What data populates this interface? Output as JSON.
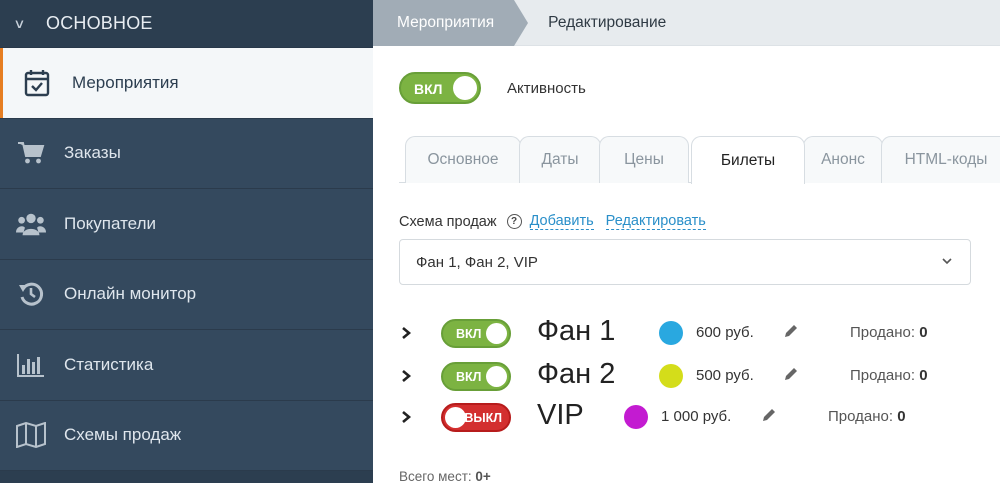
{
  "sidebar": {
    "header": "ОСНОВНОЕ",
    "items": [
      {
        "label": "Мероприятия",
        "icon": "calendar-check-icon",
        "active": true
      },
      {
        "label": "Заказы",
        "icon": "cart-icon"
      },
      {
        "label": "Покупатели",
        "icon": "users-icon"
      },
      {
        "label": "Онлайн монитор",
        "icon": "history-icon"
      },
      {
        "label": "Статистика",
        "icon": "bar-chart-icon"
      },
      {
        "label": "Схемы продаж",
        "icon": "map-icon"
      }
    ]
  },
  "breadcrumb": {
    "first": "Мероприятия",
    "second": "Редактирование"
  },
  "activity": {
    "toggle_label": "ВКЛ",
    "label": "Активность"
  },
  "tabs": [
    {
      "label": "Основное"
    },
    {
      "label": "Даты"
    },
    {
      "label": "Цены"
    },
    {
      "label": "Билеты",
      "active": true
    },
    {
      "label": "Анонс"
    },
    {
      "label": "HTML-коды"
    }
  ],
  "schema": {
    "label": "Схема продаж",
    "add_link": "Добавить",
    "edit_link": "Редактировать",
    "selected": "Фан 1, Фан 2, VIP"
  },
  "tickets": [
    {
      "toggle": "ВКЛ",
      "on": true,
      "name": "Фан 1",
      "color": "#29a8e0",
      "price": "600 руб.",
      "sold_label": "Продано:",
      "sold": "0"
    },
    {
      "toggle": "ВКЛ",
      "on": true,
      "name": "Фан 2",
      "color": "#d4dd1a",
      "price": "500 руб.",
      "sold_label": "Продано:",
      "sold": "0"
    },
    {
      "toggle": "ВЫКЛ",
      "on": false,
      "name": "VIP",
      "color": "#c31bd1",
      "price": "1 000 руб.",
      "sold_label": "Продано:",
      "sold": "0"
    }
  ],
  "total": {
    "label": "Всего мест:",
    "value": "0+"
  },
  "colors": {
    "accent": "#e67e22",
    "sidebar": "#34495e",
    "toggle_on": "#7cb342",
    "toggle_off": "#d32f2f",
    "link": "#2a8fc9"
  }
}
